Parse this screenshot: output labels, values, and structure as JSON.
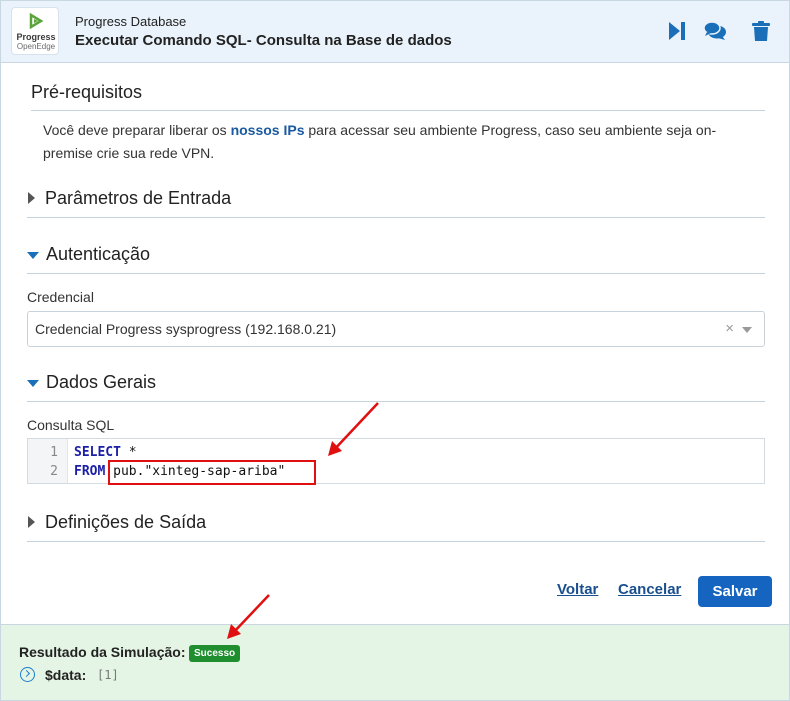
{
  "header": {
    "logo": {
      "line1": "Progress",
      "line2": "OpenEdge"
    },
    "subtitle": "Progress Database",
    "title": "Executar Comando SQL- Consulta na Base de dados",
    "icons": [
      "skip-forward-icon",
      "chat-bubbles-icon",
      "trash-icon"
    ]
  },
  "prereq": {
    "title": "Pré-requisitos",
    "text_before": "Você deve preparar liberar os ",
    "link": "nossos IPs",
    "text_after": " para acessar seu ambiente Progress, caso seu ambiente seja on-premise crie sua rede VPN."
  },
  "sections": {
    "input_params": "Parâmetros de Entrada",
    "auth": "Autenticação",
    "general": "Dados Gerais",
    "output": "Definições de Saída"
  },
  "auth": {
    "credential_label": "Credencial",
    "credential_value": "Credencial Progress sysprogress (192.168.0.21)",
    "clear_glyph": "×"
  },
  "general": {
    "sql_label": "Consulta SQL",
    "lines": [
      {
        "num": "1",
        "keyword": "SELECT",
        "rest": " *"
      },
      {
        "num": "2",
        "keyword": "FROM",
        "rest": " pub.\"xinteg-sap-ariba\""
      }
    ]
  },
  "actions": {
    "back": "Voltar",
    "cancel": "Cancelar",
    "save": "Salvar"
  },
  "result": {
    "label": "Resultado da Simulação:",
    "status": "Sucesso",
    "key": "$data:",
    "value": "[1]"
  },
  "colors": {
    "accent": "#1565c0",
    "header_bg": "#eaf3fb",
    "result_bg": "#e5f5e5",
    "success": "#1e8e2e",
    "annotation": "#e01010"
  }
}
